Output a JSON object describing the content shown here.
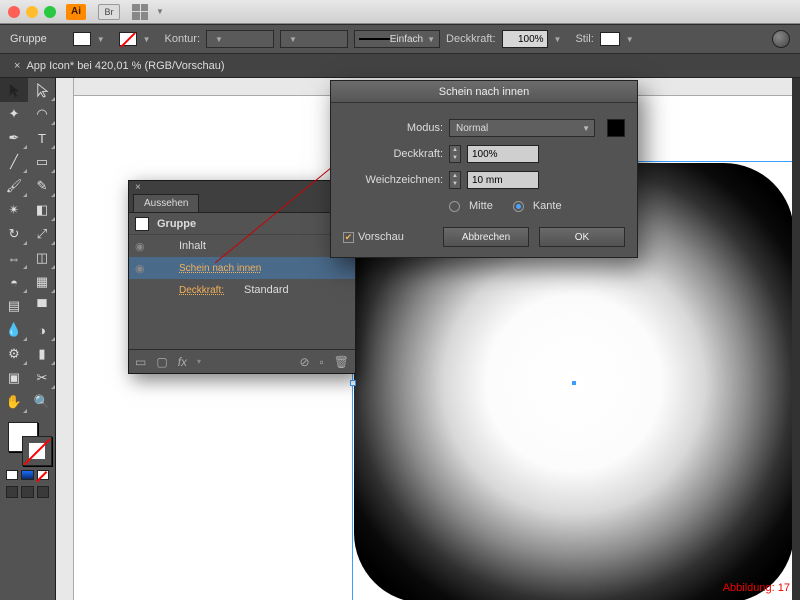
{
  "app": {
    "logo": "Ai",
    "bridge": "Br"
  },
  "ctrlbar": {
    "selection": "Gruppe",
    "kontur_label": "Kontur:",
    "stroke_style": "Einfach",
    "opacity_label": "Deckkraft:",
    "opacity_value": "100%",
    "style_label": "Stil:"
  },
  "doc_tab": "App Icon* bei 420,01 % (RGB/Vorschau)",
  "appearance": {
    "panel_title": "Aussehen",
    "group": "Gruppe",
    "contents": "Inhalt",
    "effect": "Schein nach innen",
    "opacity_label": "Deckkraft:",
    "opacity_value": "Standard",
    "fx": "fx"
  },
  "dialog": {
    "title": "Schein nach innen",
    "mode_label": "Modus:",
    "mode_value": "Normal",
    "opacity_label": "Deckkraft:",
    "opacity_value": "100%",
    "blur_label": "Weichzeichnen:",
    "blur_value": "10 mm",
    "center": "Mitte",
    "edge": "Kante",
    "preview": "Vorschau",
    "cancel": "Abbrechen",
    "ok": "OK"
  },
  "caption": "Abbildung: 17"
}
